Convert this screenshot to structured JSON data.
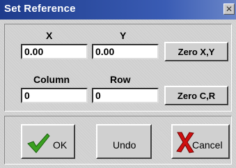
{
  "window": {
    "title": "Set Reference",
    "close_glyph": "✕"
  },
  "reference": {
    "x_label": "X",
    "y_label": "Y",
    "x_value": "0.00",
    "y_value": "0.00",
    "zero_xy_label": "Zero X,Y",
    "column_label": "Column",
    "row_label": "Row",
    "column_value": "0",
    "row_value": "0",
    "zero_cr_label": "Zero C,R"
  },
  "buttons": {
    "ok": {
      "label": "OK",
      "icon": "checkmark-icon",
      "icon_color": "#3aa020"
    },
    "undo": {
      "label": "Undo"
    },
    "cancel": {
      "label": "Cancel",
      "icon": "x-mark-icon",
      "icon_color": "#d01010"
    }
  }
}
